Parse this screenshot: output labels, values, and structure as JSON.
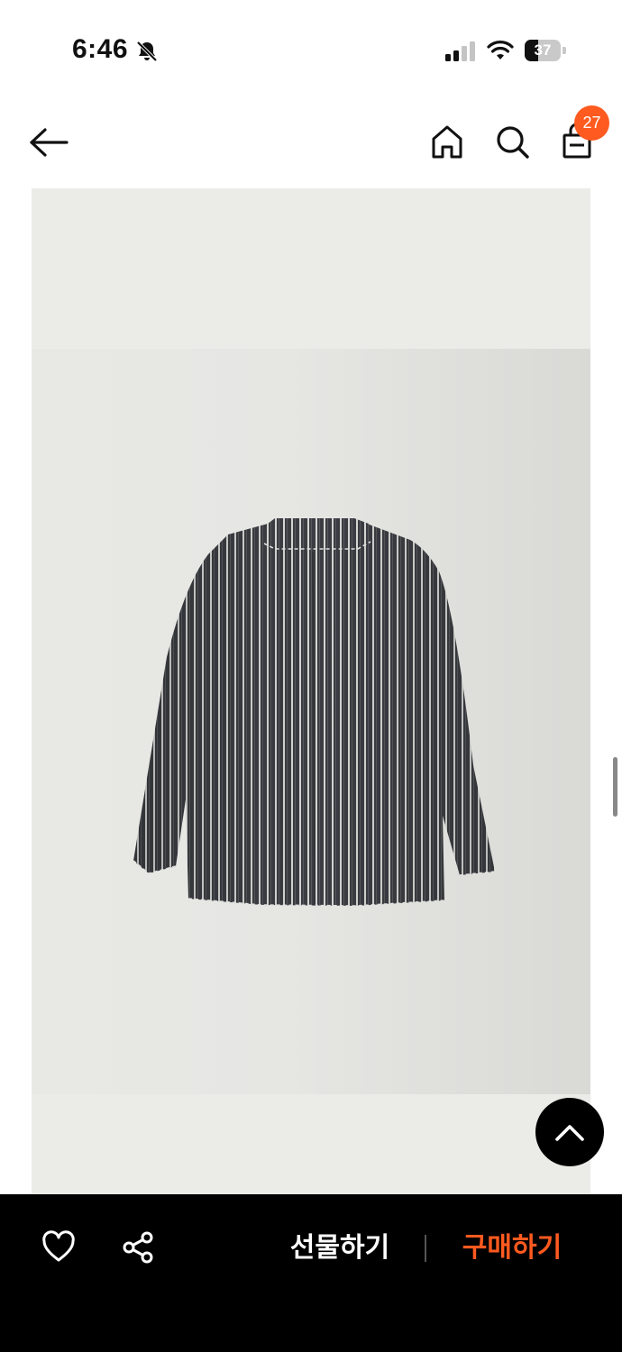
{
  "status_bar": {
    "time": "6:46",
    "battery_level": "37",
    "battery_percent": 37,
    "icons": [
      "bell-slash-icon",
      "signal-icon",
      "wifi-icon",
      "battery-icon"
    ]
  },
  "nav": {
    "icons": [
      "arrow-left-icon",
      "home-icon",
      "search-icon",
      "shopping-bag-icon"
    ],
    "cart_count": "27"
  },
  "colors": {
    "accent": "#ff5a1f",
    "bottom_bar": "#000000",
    "image_background": "#e9e9e6"
  },
  "bottom_bar": {
    "gift_label": "선물하기",
    "buy_label": "구매하기",
    "icons": [
      "heart-icon",
      "share-icon"
    ]
  },
  "scroll_top": {
    "icon": "chevron-up-icon"
  }
}
